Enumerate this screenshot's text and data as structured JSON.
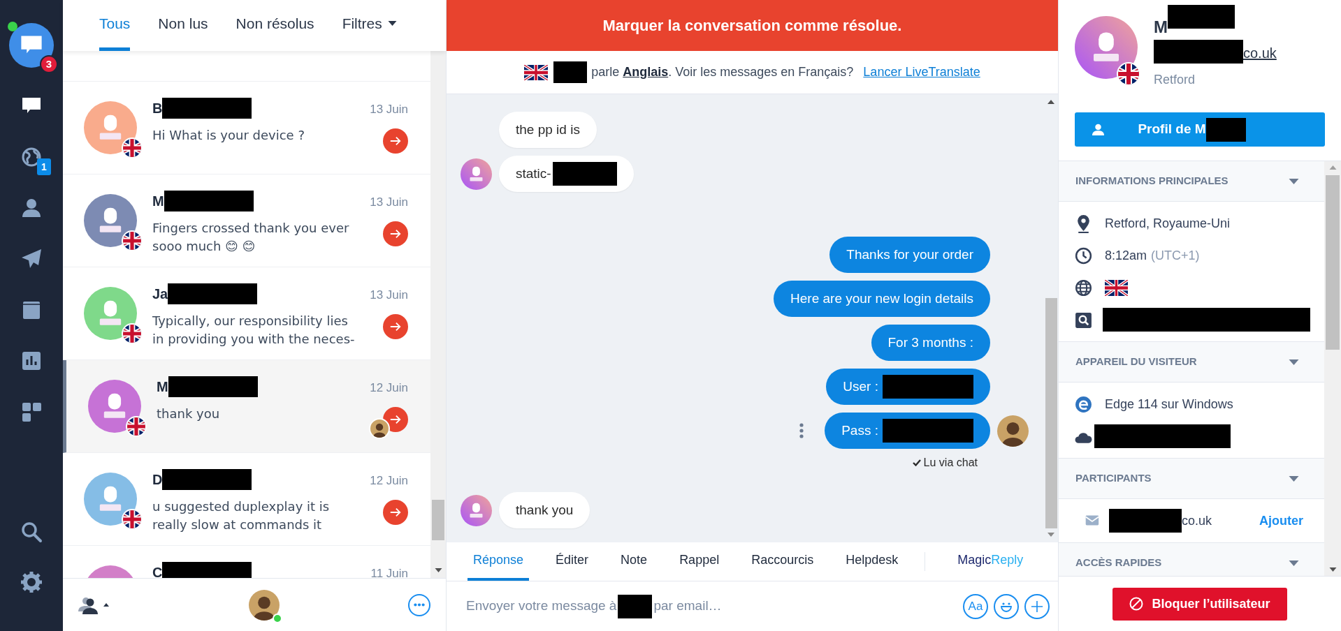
{
  "nav": {
    "logo_badge": "3",
    "online": true,
    "items": [
      {
        "selected": true
      },
      {
        "selected": false,
        "badge": "1"
      },
      {
        "selected": false
      },
      {
        "selected": false
      },
      {
        "selected": false
      },
      {
        "selected": false
      },
      {
        "selected": false
      }
    ],
    "bottom": [
      {
        "selected": false
      },
      {
        "selected": false
      }
    ]
  },
  "filters": [
    {
      "label": "Tous",
      "selected": true,
      "kind": "tab"
    },
    {
      "label": "Non lus",
      "selected": false,
      "kind": "tab"
    },
    {
      "label": "Non résolus",
      "selected": false,
      "kind": "tab"
    },
    {
      "label": "Filtres",
      "selected": false,
      "kind": "dropdown"
    }
  ],
  "conversations": [
    {
      "name": "B",
      "redacted": true,
      "date": "13 Juin",
      "preview": "Hi What is your device ?",
      "color": "#f9ab8c",
      "selected": false,
      "agent": false
    },
    {
      "name": "M",
      "redacted": true,
      "date": "13 Juin",
      "preview": "Fingers crossed thank you ever sooo much 😊 😊",
      "color": "#7d8bb3",
      "selected": false,
      "agent": false
    },
    {
      "name": "Ja",
      "redacted": true,
      "date": "13 Juin",
      "preview": "Typically, our responsibility lies in providing you with the neces-",
      "color": "#7fd98a",
      "selected": false,
      "agent": false
    },
    {
      "name": "M",
      "redacted": true,
      "date": "12 Juin",
      "preview": "thank you",
      "color": "#c672d6",
      "selected": true,
      "agent": true
    },
    {
      "name": "D",
      "redacted": true,
      "date": "12 Juin",
      "preview": "u suggested duplexplay it is really slow at commands it",
      "color": "#85bde6",
      "selected": false,
      "agent": false
    },
    {
      "name": "C",
      "redacted": true,
      "date": "11 Juin",
      "color": "#d27fc8",
      "selected": false,
      "agent": false
    }
  ],
  "banner": "Marquer la conversation comme résolue.",
  "translate": {
    "text": "parle **Anglais**. Voir les messages en Français?",
    "link": "Lancer LiveTranslate"
  },
  "messages": [
    {
      "kind": "incoming",
      "text": "the pp id is",
      "avatar": false,
      "redacted": false
    },
    {
      "kind": "incoming",
      "text": "static-",
      "avatar": true,
      "redacted": true
    },
    {
      "kind": "outgoing",
      "text": "Thanks for your order",
      "avatar": false,
      "redacted": false
    },
    {
      "kind": "outgoing",
      "text": "Here are your new login details",
      "avatar": false,
      "redacted": false
    },
    {
      "kind": "outgoing",
      "text": "For 3 months :",
      "avatar": false,
      "redacted": false
    },
    {
      "kind": "outgoing",
      "text": "User :",
      "avatar": false,
      "redacted": true
    },
    {
      "kind": "outgoing",
      "text": "Pass :",
      "avatar": true,
      "redacted": true,
      "receipt": "Lu via chat"
    },
    {
      "kind": "incoming",
      "text": "thank you",
      "avatar": true,
      "redacted": false
    }
  ],
  "composer_tabs": [
    {
      "label": "Réponse",
      "selected": true
    },
    {
      "label": "Éditer",
      "selected": false
    },
    {
      "label": "Note",
      "selected": false
    },
    {
      "label": "Rappel",
      "selected": false
    },
    {
      "label": "Raccourcis",
      "selected": false
    },
    {
      "label": "Helpdesk",
      "selected": false
    }
  ],
  "magic_reply": [
    "Magic",
    "Reply"
  ],
  "composer": {
    "placeholder_parts": [
      "Envoyer votre message à",
      "par email…"
    ],
    "font_button": "Aa"
  },
  "profile": {
    "name": "M",
    "email_end": "co.uk",
    "city": "Retford",
    "button": "Profil de M"
  },
  "sections": [
    {
      "title": "INFORMATIONS PRINCIPALES",
      "rows": [
        {
          "kind": "text",
          "text": "Retford, Royaume-Uni"
        },
        {
          "kind": "text",
          "text": "8:12am",
          "note": "(UTC+1)"
        },
        {
          "kind": "flag"
        },
        {
          "kind": "redacted"
        }
      ]
    },
    {
      "title": "APPAREIL DU VISITEUR",
      "rows": [
        {
          "kind": "text",
          "text": "Edge 114 sur Windows"
        },
        {
          "kind": "redacted"
        }
      ]
    },
    {
      "title": "PARTICIPANTS",
      "rows": [
        {
          "kind": "participant",
          "text": "co.uk",
          "action": "Ajouter"
        }
      ]
    },
    {
      "title": "ACCÈS RAPIDES"
    }
  ],
  "block_button": "Bloquer l’utilisateur"
}
